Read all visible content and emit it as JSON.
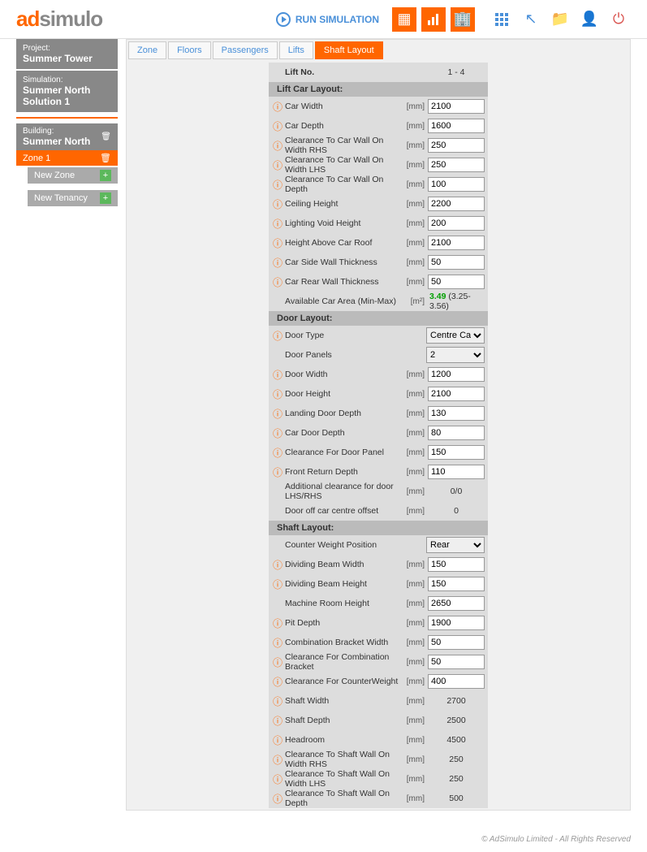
{
  "logo": {
    "part1": "ad",
    "part2": "simulo"
  },
  "header": {
    "run_label": "RUN SIMULATION"
  },
  "project": {
    "label": "Project:",
    "value": "Summer Tower"
  },
  "simulation": {
    "label": "Simulation:",
    "line1": "Summer North",
    "line2": "Solution 1"
  },
  "building": {
    "label": "Building:",
    "value": "Summer North"
  },
  "zone": {
    "label": "Zone 1"
  },
  "new_zone": "New Zone",
  "new_tenancy": "New Tenancy",
  "tabs": [
    "Zone",
    "Floors",
    "Passengers",
    "Lifts",
    "Shaft Layout"
  ],
  "active_tab": 4,
  "lift_no": {
    "label": "Lift No.",
    "value": "1 - 4"
  },
  "sections": {
    "s1": "Lift Car Layout:",
    "s2": "Door Layout:",
    "s3": "Shaft Layout:"
  },
  "rows": {
    "car_width": {
      "label": "Car Width",
      "unit": "[mm]",
      "val": "2100",
      "info": true
    },
    "car_depth": {
      "label": "Car Depth",
      "unit": "[mm]",
      "val": "1600",
      "info": true
    },
    "cl_rhs": {
      "label": "Clearance To Car Wall On Width RHS",
      "unit": "[mm]",
      "val": "250",
      "info": true
    },
    "cl_lhs": {
      "label": "Clearance To Car Wall On Width LHS",
      "unit": "[mm]",
      "val": "250",
      "info": true
    },
    "cl_depth": {
      "label": "Clearance To Car Wall On Depth",
      "unit": "[mm]",
      "val": "100",
      "info": true
    },
    "ceiling": {
      "label": "Ceiling Height",
      "unit": "[mm]",
      "val": "2200",
      "info": true
    },
    "lighting": {
      "label": "Lighting Void Height",
      "unit": "[mm]",
      "val": "200",
      "info": true
    },
    "above_roof": {
      "label": "Height Above Car Roof",
      "unit": "[mm]",
      "val": "2100",
      "info": true
    },
    "side_wall": {
      "label": "Car Side Wall Thickness",
      "unit": "[mm]",
      "val": "50",
      "info": true
    },
    "rear_wall": {
      "label": "Car Rear Wall Thickness",
      "unit": "[mm]",
      "val": "50",
      "info": true
    },
    "car_area": {
      "label": "Available Car Area (Min-Max)",
      "unit": "[m²]",
      "val_g": "3.49",
      "val_r": " (3.25-3.56)",
      "info": false
    },
    "door_type": {
      "label": "Door Type",
      "unit": "",
      "val": "Centre Car",
      "info": true,
      "select": true
    },
    "door_panels": {
      "label": "Door Panels",
      "unit": "",
      "val": "2",
      "info": false,
      "select": true
    },
    "door_width": {
      "label": "Door Width",
      "unit": "[mm]",
      "val": "1200",
      "info": true
    },
    "door_height": {
      "label": "Door Height",
      "unit": "[mm]",
      "val": "2100",
      "info": true
    },
    "landing_depth": {
      "label": "Landing Door Depth",
      "unit": "[mm]",
      "val": "130",
      "info": true
    },
    "car_door_depth": {
      "label": "Car Door Depth",
      "unit": "[mm]",
      "val": "80",
      "info": true
    },
    "cl_panel": {
      "label": "Clearance For Door Panel",
      "unit": "[mm]",
      "val": "150",
      "info": true
    },
    "front_return": {
      "label": "Front Return Depth",
      "unit": "[mm]",
      "val": "110",
      "info": true
    },
    "add_cl": {
      "label": "Additional clearance for door LHS/RHS",
      "unit": "[mm]",
      "val": "0/0",
      "info": false,
      "static": true
    },
    "door_off": {
      "label": "Door off car centre offset",
      "unit": "[mm]",
      "val": "0",
      "info": false,
      "static": true
    },
    "cw_pos": {
      "label": "Counter Weight Position",
      "unit": "",
      "val": "Rear",
      "info": false,
      "select": true
    },
    "div_beam_w": {
      "label": "Dividing Beam Width",
      "unit": "[mm]",
      "val": "150",
      "info": true
    },
    "div_beam_h": {
      "label": "Dividing Beam Height",
      "unit": "[mm]",
      "val": "150",
      "info": true
    },
    "machine_room": {
      "label": "Machine Room Height",
      "unit": "[mm]",
      "val": "2650",
      "info": false
    },
    "pit_depth": {
      "label": "Pit Depth",
      "unit": "[mm]",
      "val": "1900",
      "info": true
    },
    "comb_bracket": {
      "label": "Combination Bracket Width",
      "unit": "[mm]",
      "val": "50",
      "info": true
    },
    "cl_comb": {
      "label": "Clearance For Combination Bracket",
      "unit": "[mm]",
      "val": "50",
      "info": true
    },
    "cl_cw": {
      "label": "Clearance For CounterWeight",
      "unit": "[mm]",
      "val": "400",
      "info": true
    },
    "shaft_width": {
      "label": "Shaft Width",
      "unit": "[mm]",
      "val": "2700",
      "info": true,
      "static": true
    },
    "shaft_depth": {
      "label": "Shaft Depth",
      "unit": "[mm]",
      "val": "2500",
      "info": true,
      "static": true
    },
    "headroom": {
      "label": "Headroom",
      "unit": "[mm]",
      "val": "4500",
      "info": true,
      "static": true
    },
    "cl_sw_rhs": {
      "label": "Clearance To Shaft Wall On Width RHS",
      "unit": "[mm]",
      "val": "250",
      "info": true,
      "static": true
    },
    "cl_sw_lhs": {
      "label": "Clearance To Shaft Wall On Width LHS",
      "unit": "[mm]",
      "val": "250",
      "info": true,
      "static": true
    },
    "cl_sw_depth": {
      "label": "Clearance To Shaft Wall On Depth",
      "unit": "[mm]",
      "val": "500",
      "info": true,
      "static": true
    }
  },
  "footer": "© AdSimulo Limited - All Rights Reserved"
}
